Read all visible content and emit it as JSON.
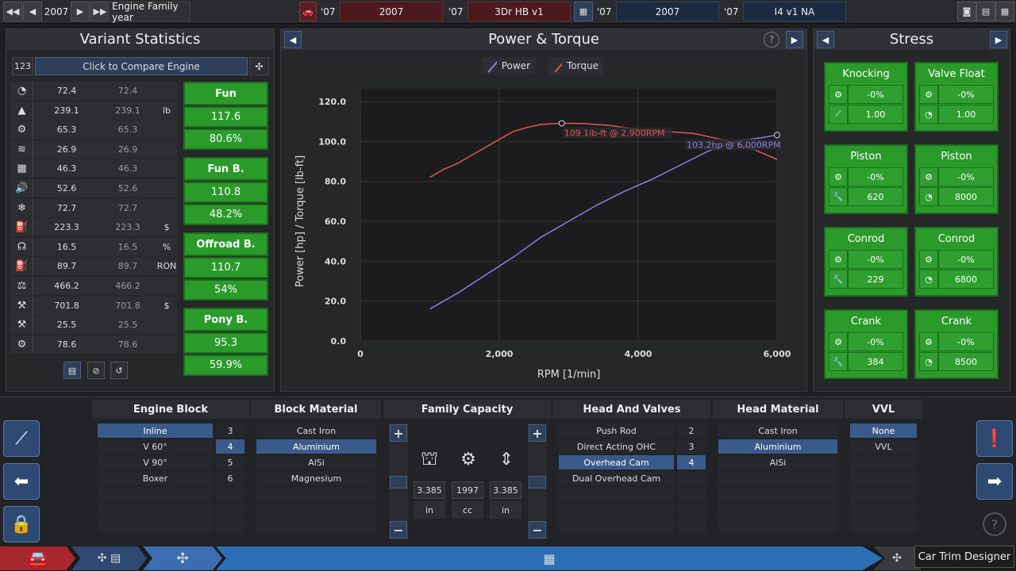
{
  "topbar": {
    "year": "2007",
    "family_label": "Engine Family year",
    "car_yr": "'07",
    "car_year": "2007",
    "car_yr2": "'07",
    "car_name": "3Dr HB v1",
    "engine_yr": "'07",
    "engine_year": "2007",
    "engine_yr2": "'07",
    "engine_name": "I4 v1 NA"
  },
  "variant": {
    "title": "Variant Statistics",
    "compare_num": "123",
    "compare_label": "Click to Compare Engine",
    "rows": [
      {
        "icon": "gauge-icon",
        "a": "72.4",
        "b": "72.4",
        "u": ""
      },
      {
        "icon": "weight-icon",
        "a": "239.1",
        "b": "239.1",
        "u": "lb"
      },
      {
        "icon": "engine-icon",
        "a": "65.3",
        "b": "65.3",
        "u": ""
      },
      {
        "icon": "smooth-icon",
        "a": "26.9",
        "b": "26.9",
        "u": ""
      },
      {
        "icon": "radiator-icon",
        "a": "46.3",
        "b": "46.3",
        "u": ""
      },
      {
        "icon": "sound-icon",
        "a": "52.6",
        "b": "52.6",
        "u": ""
      },
      {
        "icon": "snowflake-icon",
        "a": "72.7",
        "b": "72.7",
        "u": ""
      },
      {
        "icon": "cost-icon",
        "a": "223.3",
        "b": "223.3",
        "u": "$"
      },
      {
        "icon": "efficiency-icon",
        "a": "16.5",
        "b": "16.5",
        "u": "%"
      },
      {
        "icon": "fuel-icon",
        "a": "89.7",
        "b": "89.7",
        "u": "RON"
      },
      {
        "icon": "engine-weight-icon",
        "a": "466.2",
        "b": "466.2",
        "u": ""
      },
      {
        "icon": "worker-icon",
        "a": "701.8",
        "b": "701.8",
        "u": "$"
      },
      {
        "icon": "anvil-icon",
        "a": "25.5",
        "b": "25.5",
        "u": ""
      },
      {
        "icon": "cog-icon",
        "a": "78.6",
        "b": "78.6",
        "u": ""
      }
    ],
    "scores": [
      {
        "title": "Fun",
        "v1": "117.6",
        "v2": "80.6%"
      },
      {
        "title": "Fun B.",
        "v1": "110.8",
        "v2": "48.2%"
      },
      {
        "title": "Offroad B.",
        "v1": "110.7",
        "v2": "54%"
      },
      {
        "title": "Pony B.",
        "v1": "95.3",
        "v2": "59.9%"
      }
    ]
  },
  "chart_panel": {
    "title": "Power & Torque",
    "help": "?"
  },
  "chart_data": {
    "type": "line",
    "xlabel": "RPM [1/min]",
    "ylabel": "Power [hp] / Torque [lb-ft]",
    "xlim": [
      0,
      6000
    ],
    "ylim": [
      0,
      120
    ],
    "xticks": [
      "0",
      "2,000",
      "4,000",
      "6,000"
    ],
    "yticks": [
      "0.0",
      "20.0",
      "40.0",
      "60.0",
      "80.0",
      "100.0",
      "120.0"
    ],
    "legend_position": "top",
    "grid": true,
    "series": [
      {
        "name": "Power",
        "color": "#8a7fe0",
        "x": [
          1000,
          1400,
          1800,
          2200,
          2600,
          3000,
          3400,
          3800,
          4200,
          4600,
          5000,
          5400,
          5800,
          6000
        ],
        "y": [
          16,
          24,
          33,
          42,
          52,
          60,
          68,
          75,
          81,
          88,
          95,
          100,
          102,
          103.2
        ]
      },
      {
        "name": "Torque",
        "color": "#e05555",
        "x": [
          1000,
          1200,
          1400,
          1600,
          1800,
          2000,
          2200,
          2400,
          2600,
          2900,
          3200,
          3600,
          4000,
          4400,
          4800,
          5200,
          5600,
          6000
        ],
        "y": [
          82,
          86,
          89,
          93,
          97,
          101,
          105,
          107,
          108.5,
          109.1,
          109,
          108,
          106,
          105,
          104,
          101,
          97,
          91
        ]
      }
    ],
    "annotations": [
      {
        "text": "109.1lb-ft @ 2,900RPM",
        "x": 2900,
        "y": 109.1,
        "series": "Torque"
      },
      {
        "text": "103.2hp @ 6,000RPM",
        "x": 6000,
        "y": 103.2,
        "series": "Power"
      }
    ]
  },
  "stress": {
    "title": "Stress",
    "groups": [
      {
        "title": "Knocking",
        "pct": "-0%",
        "val": "1.00",
        "icon2": "lever-icon"
      },
      {
        "title": "Valve Float",
        "pct": "-0%",
        "val": "1.00",
        "icon2": "tacho-icon"
      },
      {
        "title": "Piston",
        "pct": "-0%",
        "val": "620",
        "icon2": "wrench-icon"
      },
      {
        "title": "Piston",
        "pct": "-0%",
        "val": "8000",
        "icon2": "tacho-icon"
      },
      {
        "title": "Conrod",
        "pct": "-0%",
        "val": "229",
        "icon2": "wrench-icon"
      },
      {
        "title": "Conrod",
        "pct": "-0%",
        "val": "6800",
        "icon2": "tacho-icon"
      },
      {
        "title": "Crank",
        "pct": "-0%",
        "val": "384",
        "icon2": "wrench-icon"
      },
      {
        "title": "Crank",
        "pct": "-0%",
        "val": "8500",
        "icon2": "tacho-icon"
      }
    ]
  },
  "engine_block": {
    "title": "Engine Block",
    "options": [
      "Inline",
      "V 60°",
      "V 90°",
      "Boxer"
    ],
    "cyl": [
      "3",
      "4",
      "5",
      "6"
    ]
  },
  "block_material": {
    "title": "Block Material",
    "options": [
      "Cast Iron",
      "Aluminium",
      "AlSi",
      "Magnesium"
    ]
  },
  "family_capacity": {
    "title": "Family Capacity",
    "bore": "3.385",
    "capacity": "1997",
    "stroke": "3.385",
    "bore_unit": "in",
    "cap_unit": "cc",
    "stroke_unit": "in"
  },
  "head_valves": {
    "title": "Head And Valves",
    "options": [
      "Push Rod",
      "Direct Acting OHC",
      "Overhead Cam",
      "Dual Overhead Cam"
    ],
    "valves": [
      "2",
      "3",
      "4"
    ]
  },
  "head_material": {
    "title": "Head Material",
    "options": [
      "Cast Iron",
      "Aluminium",
      "AlSi"
    ]
  },
  "vvl": {
    "title": "VVL",
    "options": [
      "None",
      "VVL"
    ]
  },
  "footer": {
    "tooltip": "Car Trim Designer",
    "help": "?"
  }
}
